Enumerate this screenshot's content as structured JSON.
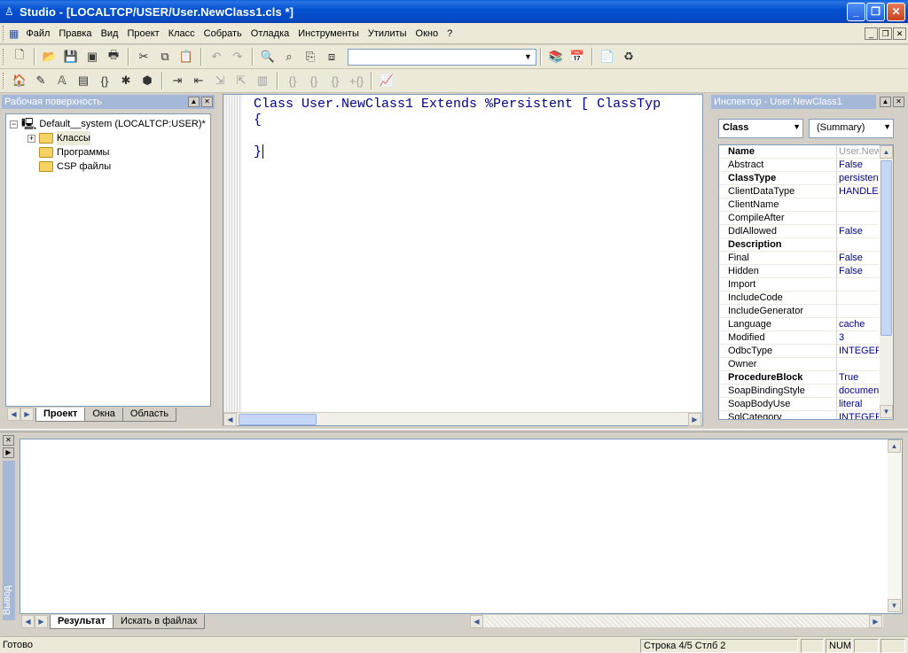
{
  "window": {
    "title": "Studio - [LOCALTCP/USER/User.NewClass1.cls *]"
  },
  "menu": [
    "Файл",
    "Правка",
    "Вид",
    "Проект",
    "Класс",
    "Собрать",
    "Отладка",
    "Инструменты",
    "Утилиты",
    "Окно",
    "?"
  ],
  "workspace": {
    "title": "Рабочая поверхность",
    "root": "Default__system  (LOCALTCP:USER)*",
    "items": [
      "Классы",
      "Программы",
      "CSP файлы"
    ],
    "tabs": [
      "Проект",
      "Окна",
      "Область"
    ]
  },
  "editor": {
    "line1": "Class User.NewClass1 Extends %Persistent [ ClassTyp",
    "line2": "{",
    "line3": "}"
  },
  "inspector": {
    "title": "Инспектор - User.NewClass1",
    "type_select": "Class",
    "view_select": "(Summary)",
    "props": [
      {
        "name": "Name",
        "value": "User.New",
        "bold": true,
        "grey": true
      },
      {
        "name": "Abstract",
        "value": "False"
      },
      {
        "name": "ClassType",
        "value": "persistent",
        "bold": true
      },
      {
        "name": "ClientDataType",
        "value": "HANDLE"
      },
      {
        "name": "ClientName",
        "value": ""
      },
      {
        "name": "CompileAfter",
        "value": ""
      },
      {
        "name": "DdlAllowed",
        "value": "False"
      },
      {
        "name": "Description",
        "value": "",
        "bold": true
      },
      {
        "name": "Final",
        "value": "False"
      },
      {
        "name": "Hidden",
        "value": "False"
      },
      {
        "name": "Import",
        "value": ""
      },
      {
        "name": "IncludeCode",
        "value": ""
      },
      {
        "name": "IncludeGenerator",
        "value": ""
      },
      {
        "name": "Language",
        "value": "cache"
      },
      {
        "name": "Modified",
        "value": "3"
      },
      {
        "name": "OdbcType",
        "value": "INTEGEF"
      },
      {
        "name": "Owner",
        "value": ""
      },
      {
        "name": "ProcedureBlock",
        "value": "True",
        "bold": true
      },
      {
        "name": "SoapBindingStyle",
        "value": "documen"
      },
      {
        "name": "SoapBodyUse",
        "value": "literal"
      },
      {
        "name": "SqlCategory",
        "value": "INTEGEF"
      }
    ]
  },
  "output": {
    "side_label": "Вывод",
    "tabs": [
      "Результат",
      "Искать в файлах"
    ]
  },
  "status": {
    "ready": "Готово",
    "position": "Строка 4/5 Стлб 2",
    "num": "NUM"
  }
}
